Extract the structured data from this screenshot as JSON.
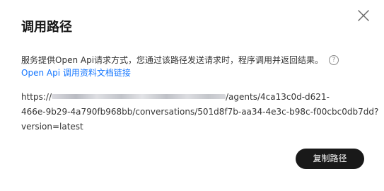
{
  "dialog": {
    "title": "调用路径",
    "close_icon": "close-icon",
    "description": "服务提供Open Api请求方式，您通过该路径发送请求时，程序调用并返回结果。",
    "help_icon": "help-icon",
    "help_glyph": "?",
    "doc_link": "Open Api 调用资料文档链接",
    "url": {
      "prefix": "https://",
      "line1_suffix": "/agents/4ca13c0d-d621-",
      "line2": "466e-9b29-4a790fb968bb/conversations/501d8f7b-aa34-4e3c-b98c-f00cbc0db7dd?",
      "line3": "version=latest"
    },
    "copy_button": "复制路径"
  }
}
